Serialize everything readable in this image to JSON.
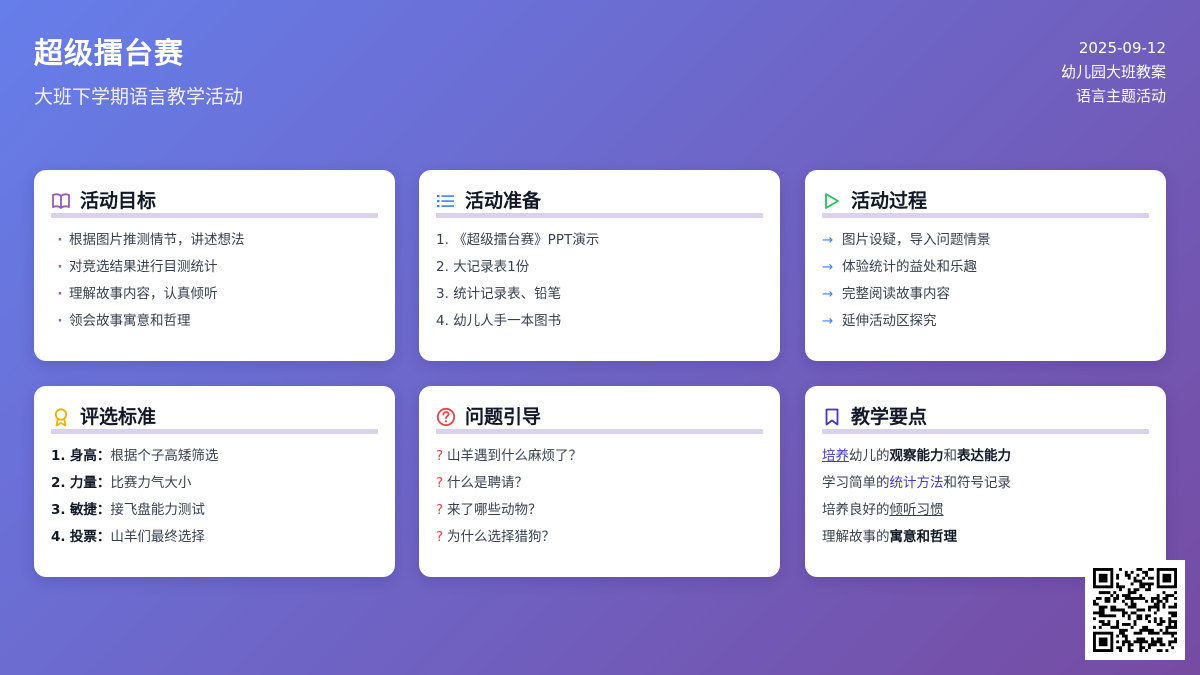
{
  "header": {
    "title": "超级擂台赛",
    "subtitle": "大班下学期语言教学活动",
    "date": "2025-09-12",
    "category": "幼儿园大班教案",
    "theme": "语言主题活动"
  },
  "cards": {
    "goals": {
      "title": "活动目标",
      "icon": "book-icon",
      "items": [
        "根据图片推测情节，讲述想法",
        "对竞选结果进行目测统计",
        "理解故事内容，认真倾听",
        "领会故事寓意和哲理"
      ]
    },
    "prep": {
      "title": "活动准备",
      "icon": "list-icon",
      "items": [
        {
          "num": "1.",
          "text": "《超级擂台赛》PPT演示"
        },
        {
          "num": "2.",
          "text": "大记录表1份"
        },
        {
          "num": "3.",
          "text": "统计记录表、铅笔"
        },
        {
          "num": "4.",
          "text": "幼儿人手一本图书"
        }
      ]
    },
    "process": {
      "title": "活动过程",
      "icon": "play-icon",
      "items": [
        "图片设疑，导入问题情景",
        "体验统计的益处和乐趣",
        "完整阅读故事内容",
        "延伸活动区探究"
      ]
    },
    "criteria": {
      "title": "评选标准",
      "icon": "award-icon",
      "items": [
        {
          "num": "1.",
          "term": "身高",
          "text": "根据个子高矮筛选"
        },
        {
          "num": "2.",
          "term": "力量",
          "text": "比赛力气大小"
        },
        {
          "num": "3.",
          "term": "敏捷",
          "text": "接飞盘能力测试"
        },
        {
          "num": "4.",
          "term": "投票",
          "text": "山羊们最终选择"
        }
      ]
    },
    "questions": {
      "title": "问题引导",
      "icon": "question-circle-icon",
      "items": [
        "山羊遇到什么麻烦了？",
        "什么是聘请？",
        "来了哪些动物？",
        "为什么选择猎狗？"
      ]
    },
    "keypoints": {
      "title": "教学要点",
      "icon": "bookmark-icon",
      "line1": {
        "a": "培养",
        "b": "幼儿的",
        "c": "观察能力",
        "d": "和",
        "e": "表达能力"
      },
      "line2": {
        "a": "学习简单的",
        "b": "统计方法",
        "c": "和符号记录"
      },
      "line3": {
        "a": "培养良好的",
        "b": "倾听习惯"
      },
      "line4": {
        "a": "理解故事的",
        "b": "寓意和哲理"
      }
    }
  },
  "colors": {
    "bg_start": "#667eea",
    "bg_end": "#764ba2",
    "card_underline": "#d9d2ea",
    "accent_purple": "#9b59b6",
    "accent_blue": "#3b82f6",
    "accent_green": "#22c55e",
    "accent_gold": "#eab308",
    "accent_red": "#ef4444",
    "accent_indigo": "#4338ca"
  },
  "qr": {
    "icon": "qr-code-icon"
  }
}
